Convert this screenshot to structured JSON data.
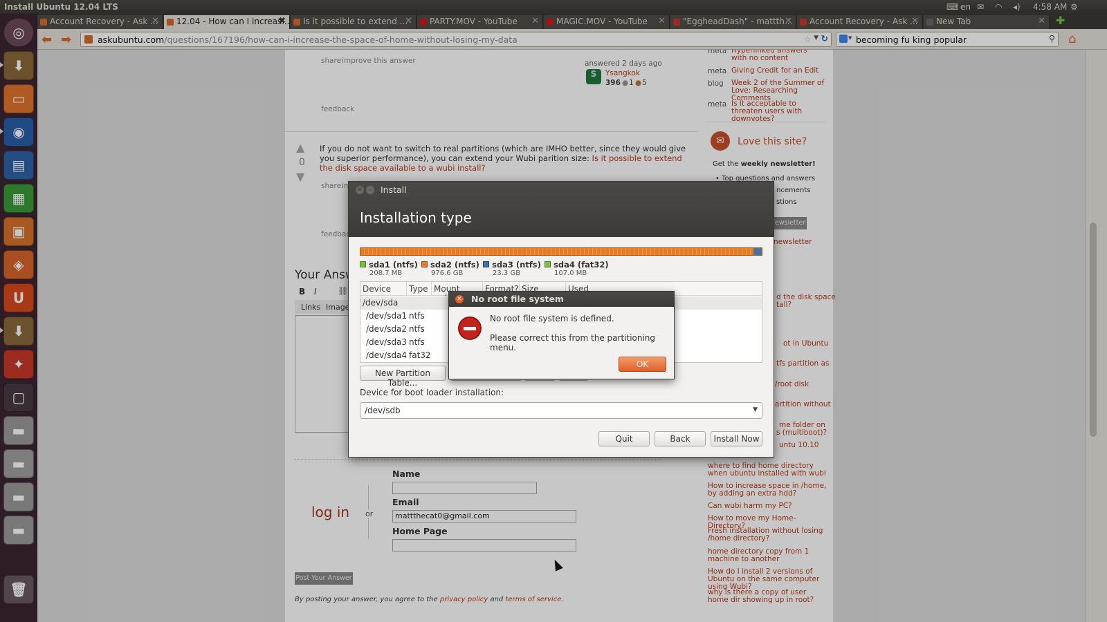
{
  "top_panel": {
    "window_title": "Install Ubuntu 12.04 LTS",
    "keyboard_layout": "en",
    "time": "4:58 AM"
  },
  "launcher": {
    "items": [
      "dash-home",
      "ubuntu-installer",
      "files",
      "firefox",
      "writer",
      "calc",
      "impress",
      "software-center",
      "ubuntu-one",
      "installer-2",
      "system-settings",
      "workspaces",
      "drive-1",
      "drive-2",
      "drive-3",
      "drive-4",
      "trash"
    ]
  },
  "browser": {
    "tabs": [
      {
        "label": "Account Recovery - Ask ..."
      },
      {
        "label": "12.04 - How can I increas..."
      },
      {
        "label": "Is it possible to extend ..."
      },
      {
        "label": "PARTY.MOV - YouTube"
      },
      {
        "label": "MAGIC.MOV - YouTube"
      },
      {
        "label": "\"EggheadDash\" - mattth..."
      },
      {
        "label": "Account Recovery - Ask ..."
      },
      {
        "label": "New Tab"
      }
    ],
    "url_host": "askubuntu.com",
    "url_path": "/questions/167196/how-can-i-increase-the-space-of-home-without-losing-my-data",
    "search_value": "becoming fu king popular"
  },
  "page": {
    "answer1": {
      "share": "share",
      "improve": "improve this answer",
      "answered": "answered 2 days ago",
      "user": "Ysangkok",
      "rep": "396",
      "silver": "1",
      "bronze": "5",
      "feedback": "feedback"
    },
    "answer2": {
      "vote_count": "0",
      "text1": "If you do not want to switch to real partitions (which are IMHO better, since they would give you",
      "text2": "superior performance), you can extend your Wubi parition size:",
      "link1": "Is it possible to extend the disk space",
      "link2": "available to a wubi install?",
      "share": "share",
      "improve_partial": "im",
      "feedback": "feedback"
    },
    "your_answer": "Your Answ",
    "editor": {
      "bold": "B",
      "italic": "I",
      "links": "Links",
      "images": "Images"
    },
    "login": {
      "title": "log in",
      "or": "or",
      "name_label": "Name",
      "email_label": "Email",
      "email_value": "mattthecat0@gmail.com",
      "home_label": "Home Page",
      "post_button": "Post Your Answer",
      "terms_prefix": "By posting your answer, you agree to the",
      "privacy": "privacy policy",
      "and": "and",
      "terms": "terms of service."
    },
    "sidebar": {
      "meta_items": [
        {
          "tag": "meta",
          "title": "Hyperlinked answers with no content"
        },
        {
          "tag": "meta",
          "title": "Giving Credit for an Edit"
        },
        {
          "tag": "blog",
          "title": "Week 2 of the Summer of Love: Researching Comments"
        },
        {
          "tag": "meta",
          "title": "Is it acceptable to threaten users with downvotes?"
        }
      ],
      "love_title": "Love this site?",
      "newsletter_prefix": "Get the",
      "newsletter_bold": "weekly newsletter!",
      "bullets": [
        "Top questions and answers",
        "ncements",
        "stions"
      ],
      "newsletter_button": "ewsletter",
      "newsletter_link": "newsletter",
      "partial_links": [
        "d the disk space",
        "tall?",
        "ot in Ubuntu",
        "tfs partition as",
        "/root disk",
        "artition without",
        "me folder on",
        "s (multiboot)?",
        "untu 10.10"
      ],
      "related": [
        "where to find home directory when ubuntu installed with wubi",
        "How to increase space in /home, by adding an extra hdd?",
        "Can wubi harm my PC?",
        "How to move my Home-Directory?",
        "Fresh installation without losing /home directory?",
        "home directory copy from 1 machine to another",
        "How do I install 2 versions of Ubuntu on the same computer using Wubi?",
        "why is there a copy of user home dir showing up in root?"
      ]
    }
  },
  "install_dialog": {
    "window_title": "Install",
    "heading": "Installation type",
    "legend": [
      {
        "name": "sda1 (ntfs)",
        "size": "208.7 MB",
        "color": "#77c23f"
      },
      {
        "name": "sda2 (ntfs)",
        "size": "976.6 GB",
        "color": "#e57b22"
      },
      {
        "name": "sda3 (ntfs)",
        "size": "23.3 GB",
        "color": "#3f74b0"
      },
      {
        "name": "sda4 (fat32)",
        "size": "107.0 MB",
        "color": "#77c23f"
      }
    ],
    "columns": [
      "Device",
      "Type",
      "Mount point",
      "Format?",
      "Size",
      "Used"
    ],
    "rows": [
      {
        "device": "/dev/sda",
        "type": ""
      },
      {
        "device": "/dev/sda1",
        "type": "ntfs"
      },
      {
        "device": "/dev/sda2",
        "type": "ntfs"
      },
      {
        "device": "/dev/sda3",
        "type": "ntfs"
      },
      {
        "device": "/dev/sda4",
        "type": "fat32"
      }
    ],
    "new_table_button": "New Partition Table...",
    "boot_label": "Device for boot loader installation:",
    "boot_device": "/dev/sdb",
    "quit": "Quit",
    "back": "Back",
    "install_now": "Install Now"
  },
  "error_dialog": {
    "title": "No root file system",
    "message1": "No root file system is defined.",
    "message2": "Please correct this from the partitioning menu.",
    "ok": "OK"
  }
}
